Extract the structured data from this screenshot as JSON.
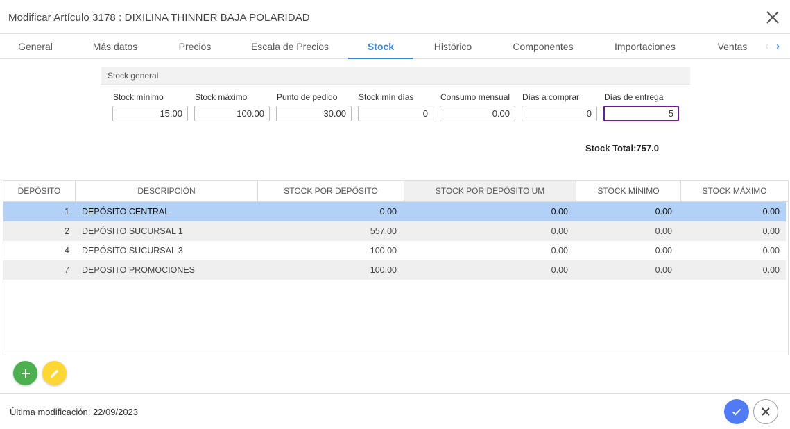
{
  "window": {
    "title": "Modificar Artículo 3178 : DIXILINA THINNER BAJA POLARIDAD",
    "close_icon": "close-icon"
  },
  "tabs": [
    {
      "label": "General"
    },
    {
      "label": "Más datos"
    },
    {
      "label": "Precios"
    },
    {
      "label": "Escala de Precios"
    },
    {
      "label": "Stock",
      "active": true
    },
    {
      "label": "Histórico"
    },
    {
      "label": "Componentes"
    },
    {
      "label": "Importaciones"
    },
    {
      "label": "Ventas"
    }
  ],
  "stock_general": {
    "title": "Stock general",
    "fields": [
      {
        "label": "Stock mínimo",
        "value": "15.00"
      },
      {
        "label": "Stock máximo",
        "value": "100.00"
      },
      {
        "label": "Punto de pedido",
        "value": "30.00"
      },
      {
        "label": "Stock mín días",
        "value": "0"
      },
      {
        "label": "Consumo mensual",
        "value": "0.00"
      },
      {
        "label": "Días a comprar",
        "value": "0"
      },
      {
        "label": "Días de entrega",
        "value": "5",
        "focused": true
      }
    ],
    "stock_total": "Stock Total:757.0"
  },
  "table": {
    "columns": [
      "DEPÓSITO",
      "DESCRIPCIÓN",
      "STOCK POR DEPÓSITO",
      "STOCK POR DEPÓSITO UM",
      "STOCK MÍNIMO",
      "STOCK MÁXIMO"
    ],
    "rows": [
      {
        "deposito": "1",
        "descripcion": "DEPÓSITO CENTRAL",
        "stock": "0.00",
        "stock_um": "0.00",
        "minimo": "0.00",
        "maximo": "0.00",
        "selected": true
      },
      {
        "deposito": "2",
        "descripcion": "DEPÓSITO SUCURSAL 1",
        "stock": "557.00",
        "stock_um": "0.00",
        "minimo": "0.00",
        "maximo": "0.00"
      },
      {
        "deposito": "4",
        "descripcion": "DEPÓSITO SUCURSAL 3",
        "stock": "100.00",
        "stock_um": "0.00",
        "minimo": "0.00",
        "maximo": "0.00"
      },
      {
        "deposito": "7",
        "descripcion": "DEPOSITO PROMOCIONES",
        "stock": "100.00",
        "stock_um": "0.00",
        "minimo": "0.00",
        "maximo": "0.00"
      }
    ]
  },
  "actions": {
    "add_icon": "plus-icon",
    "edit_icon": "pencil-icon"
  },
  "footer": {
    "modification_label": "Última modificación:",
    "modification_date": "22/09/2023",
    "confirm_icon": "check-icon",
    "cancel_icon": "close-icon"
  },
  "colors": {
    "accent": "#3d8be0",
    "selected_row": "#b3d1f7",
    "focused_border": "#6a1b9a",
    "add_button": "#4caf50",
    "edit_button": "#fdd835",
    "confirm_button": "#4f7bf5"
  }
}
